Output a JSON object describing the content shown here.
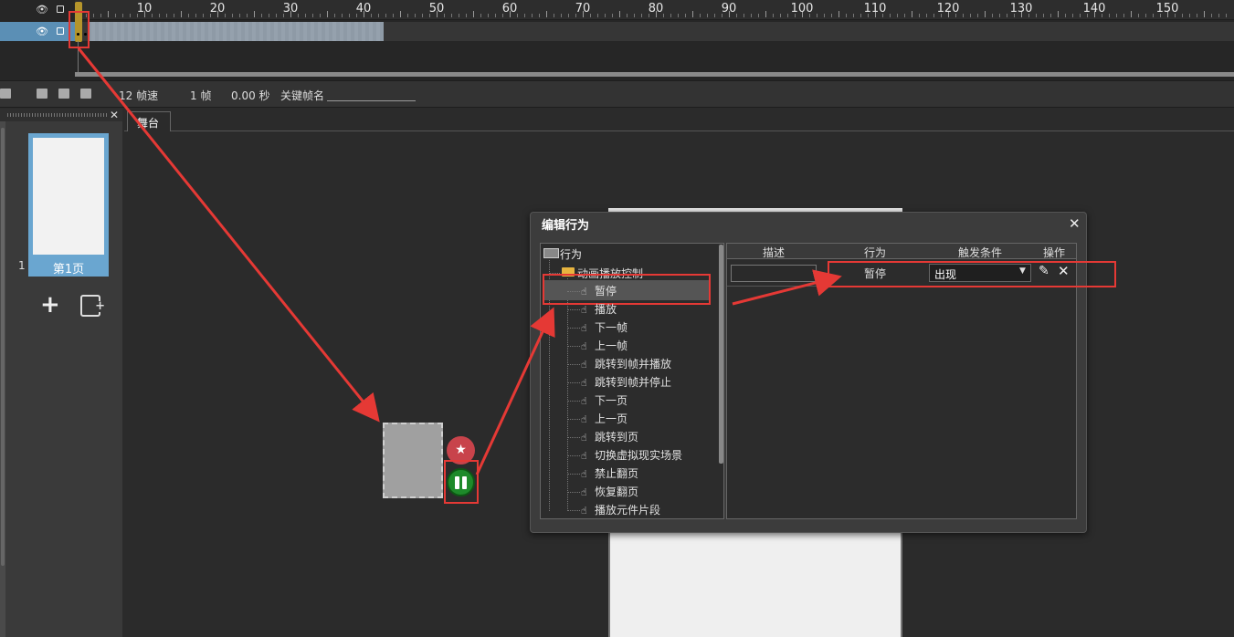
{
  "timeline": {
    "ruler_numbers": [
      "10",
      "20",
      "30",
      "40",
      "50",
      "60",
      "70",
      "80",
      "90",
      "100",
      "110",
      "120",
      "130",
      "140",
      "150"
    ],
    "toolbar": {
      "frame_rate": "12 帧速",
      "current_frame": "1 帧",
      "time": "0.00 秒",
      "keyframe_name_label": "关键帧名"
    }
  },
  "pages_panel": {
    "close_glyph": "✕",
    "page_number": "1",
    "page_label": "第1页",
    "add_glyph": "+"
  },
  "stage": {
    "tab_label": "舞台"
  },
  "dialog": {
    "title": "编辑行为",
    "close_glyph": "✕",
    "tree": {
      "root": "行为",
      "folder": "动画播放控制",
      "items": [
        "暂停",
        "播放",
        "下一帧",
        "上一帧",
        "跳转到帧并播放",
        "跳转到帧并停止",
        "下一页",
        "上一页",
        "跳转到页",
        "切换虚拟现实场景",
        "禁止翻页",
        "恢复翻页",
        "播放元件片段"
      ]
    },
    "table": {
      "headers": {
        "desc": "描述",
        "behavior": "行为",
        "trigger": "触发条件",
        "action": "操作"
      },
      "row": {
        "desc": "",
        "behavior": "暂停",
        "trigger": "出现"
      }
    }
  },
  "icons": {
    "visibility": "eye-icon",
    "lock": "lock-icon",
    "favorite": "star-add-icon",
    "pause": "pause-icon",
    "edit": "pencil-icon",
    "delete": "close-icon",
    "hand": "hand-pointer-icon"
  },
  "colors": {
    "highlight": "#e53935",
    "layer_selected": "#5b8fb5",
    "pause_green": "#1e8a2a",
    "favorite_red": "#c8434b",
    "playhead": "#b5952b"
  }
}
